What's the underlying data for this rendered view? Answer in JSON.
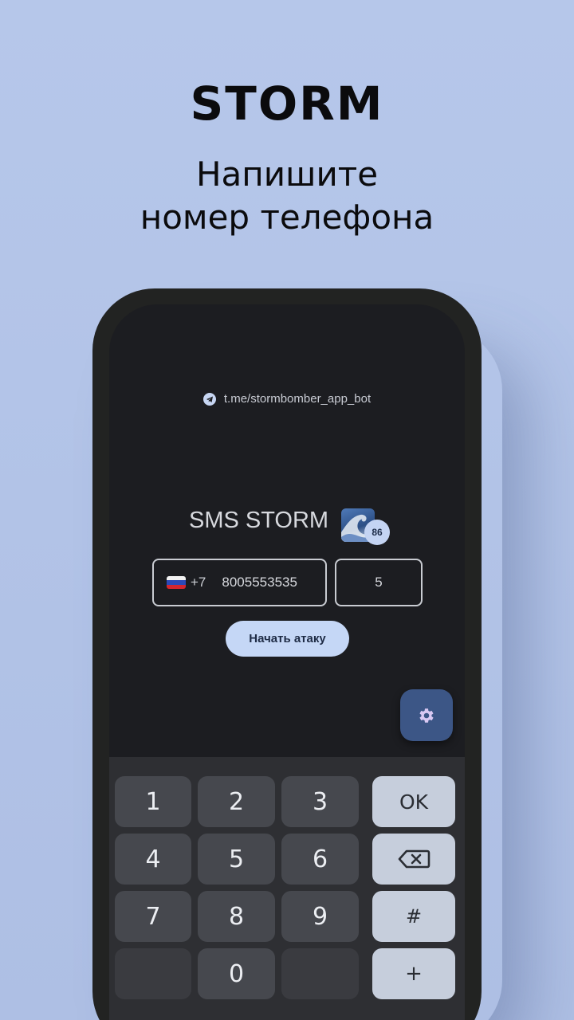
{
  "promo": {
    "title": "STORM",
    "subtitle_line1": "Напишите",
    "subtitle_line2": "номер телефона"
  },
  "app": {
    "telegram_link": "t.me/stormbomber_app_bot",
    "title": "SMS STORM",
    "badge_count": "86",
    "country_code": "+7",
    "phone_value": "8005553535",
    "count_value": "5",
    "attack_button": "Начать атаку",
    "settings_icon": "gear-icon"
  },
  "keyboard": {
    "keys": [
      "1",
      "2",
      "3",
      "4",
      "5",
      "6",
      "7",
      "8",
      "9",
      "0"
    ],
    "ok": "OK",
    "hash": "#",
    "plus": "+",
    "backspace_icon": "backspace-icon"
  },
  "colors": {
    "background": "#b5c6e8",
    "screen": "#1c1d21",
    "accent": "#c5d7f6",
    "fab": "#3c5686"
  }
}
